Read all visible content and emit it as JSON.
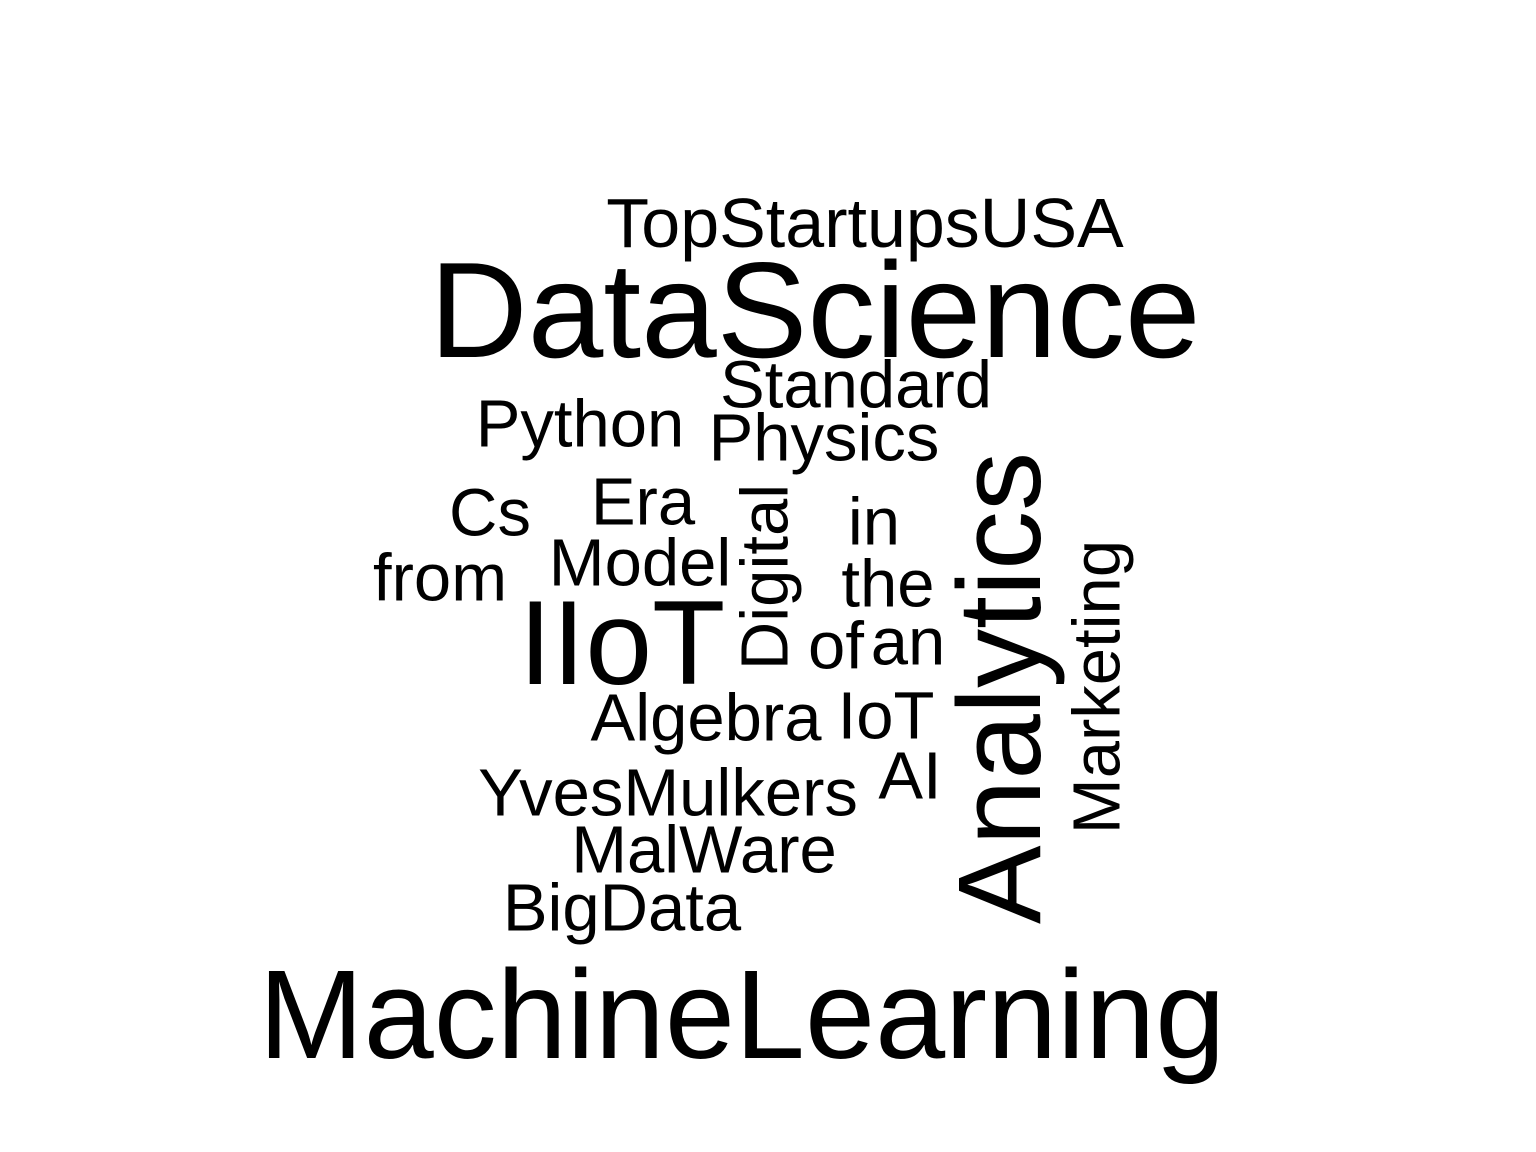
{
  "colors": {
    "background": "#ffffff",
    "text": "#000000"
  },
  "words": {
    "top_startups_usa": "TopStartupsUSA",
    "data_science": "DataScience",
    "standard": "Standard",
    "python": "Python",
    "physics": "Physics",
    "analytics": "Analytics",
    "era": "Era",
    "cs": "Cs",
    "digital": "Digital",
    "in": "in",
    "model": "Model",
    "from": "from",
    "the": "the",
    "marketing": "Marketing",
    "iiot": "IIoT",
    "of": "of",
    "an": "an",
    "algebra": "Algebra",
    "iot": "IoT",
    "ai": "AI",
    "yves_mulkers": "YvesMulkers",
    "malware": "MalWare",
    "big_data": "BigData",
    "machine_learning": "MachineLearning"
  }
}
